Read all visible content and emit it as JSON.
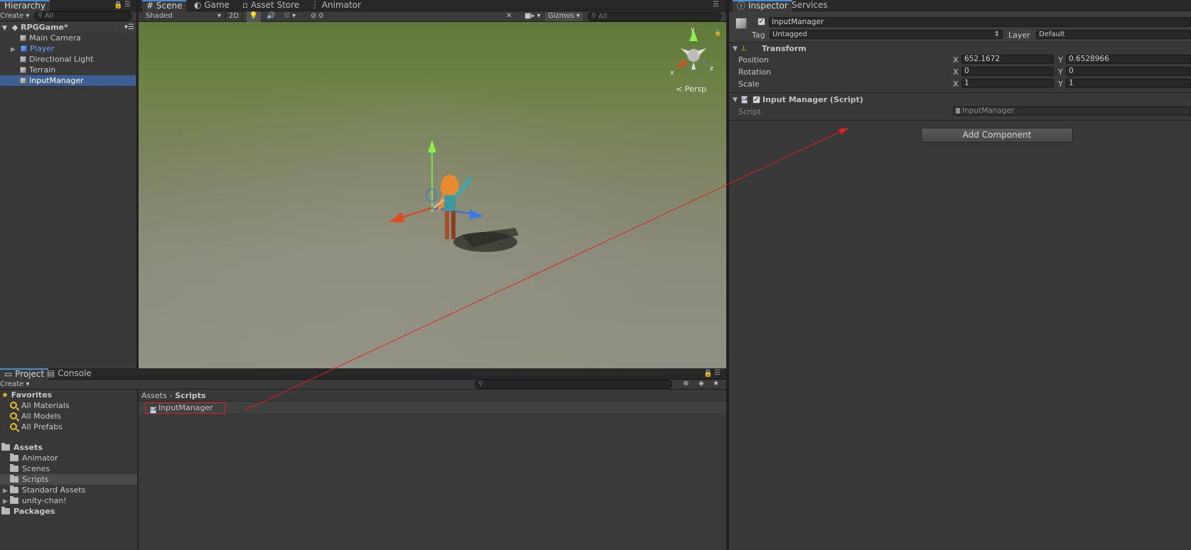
{
  "hierarchy": {
    "tab": "Hierarchy",
    "create": "Create ▾",
    "search_placeholder": "All",
    "scene_name": "RPGGame*",
    "items": [
      {
        "label": "Main Camera"
      },
      {
        "label": "Player"
      },
      {
        "label": "Directional Light"
      },
      {
        "label": "Terrain"
      },
      {
        "label": "InputManager"
      }
    ]
  },
  "scene_view": {
    "tabs": [
      "Scene",
      "Game",
      "Asset Store",
      "Animator"
    ],
    "shading": "Shaded",
    "mode_2d": "2D",
    "hidden_count": "0",
    "gizmos": "Gizmos",
    "search_placeholder": "All",
    "persp": "< Persp",
    "axis_y": "y",
    "axis_x": "x",
    "axis_z": "z"
  },
  "project": {
    "tabs": [
      "Project",
      "Console"
    ],
    "create": "Create ▾",
    "favorites_label": "Favorites",
    "favorites": [
      "All Materials",
      "All Models",
      "All Prefabs"
    ],
    "assets_label": "Assets",
    "assets": [
      "Animator",
      "Scenes",
      "Scripts",
      "Standard Assets",
      "unity-chan!"
    ],
    "packages_label": "Packages",
    "breadcrumb_root": "Assets",
    "breadcrumb_current": "Scripts",
    "files": [
      {
        "name": "InputManager",
        "icon": "csharp-script-icon"
      }
    ]
  },
  "inspector": {
    "tabs": [
      "Inspector",
      "Services"
    ],
    "object_name": "InputManager",
    "tag_label": "Tag",
    "tag_value": "Untagged",
    "layer_label": "Layer",
    "layer_value": "Default",
    "transform": {
      "title": "Transform",
      "position_label": "Position",
      "rotation_label": "Rotation",
      "scale_label": "Scale",
      "x_label": "X",
      "y_label": "Y",
      "position_x": "652.1672",
      "position_y": "0.6528966",
      "rotation_x": "0",
      "rotation_y": "0",
      "scale_x": "1",
      "scale_y": "1"
    },
    "script_component": {
      "title": "Input Manager (Script)",
      "script_label": "Script",
      "script_value": "InputManager"
    },
    "add_component": "Add Component"
  },
  "colors": {
    "selection": "#3e5f96",
    "accent_tab": "#4a8ad6",
    "annotation": "#e02020"
  }
}
